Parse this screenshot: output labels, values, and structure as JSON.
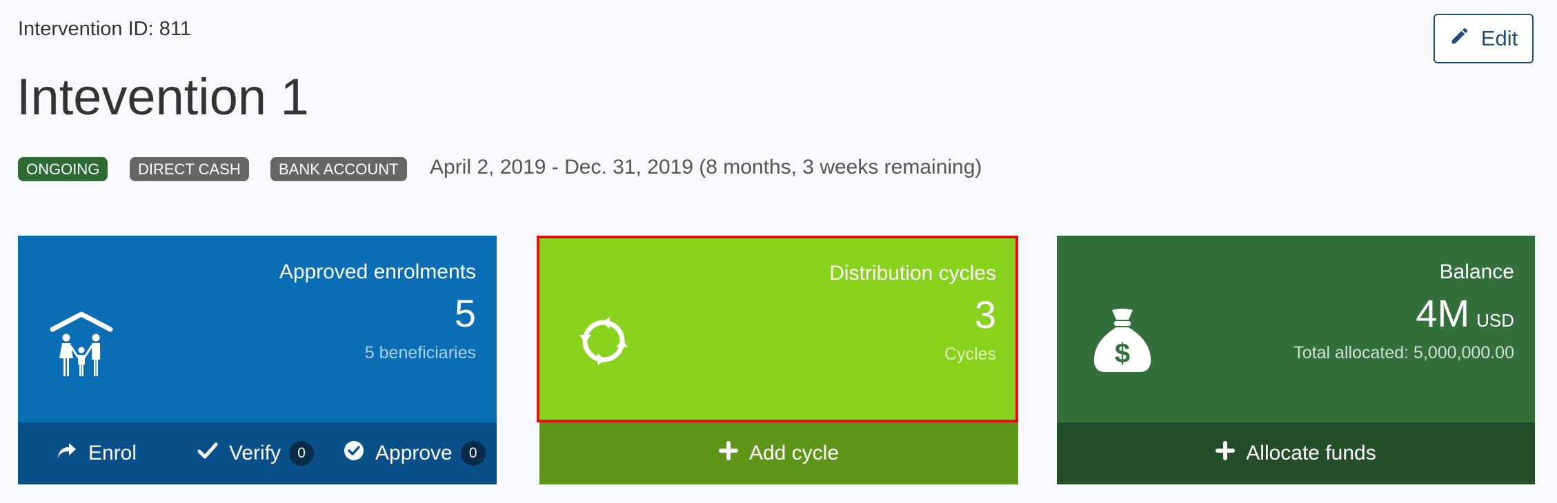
{
  "header": {
    "intervention_id": "Intervention ID: 811",
    "title": "Intevention 1",
    "edit_label": "Edit",
    "badges": {
      "status": "ONGOING",
      "type": "DIRECT CASH",
      "method": "BANK ACCOUNT"
    },
    "date_range": "April 2, 2019 - Dec. 31, 2019 (8 months, 3 weeks remaining)"
  },
  "cards": {
    "enrolments": {
      "title": "Approved enrolments",
      "value": "5",
      "subtitle": "5 beneficiaries",
      "icon": "family-shelter-icon",
      "color": "#0b6db4",
      "actions": {
        "enrol": "Enrol",
        "verify": "Verify",
        "verify_count": "0",
        "approve": "Approve",
        "approve_count": "0"
      }
    },
    "cycles": {
      "title": "Distribution cycles",
      "value": "3",
      "subtitle": "Cycles",
      "icon": "refresh-cycle-icon",
      "color": "#88d11d",
      "highlight_color": "#e01010",
      "action": "Add cycle"
    },
    "balance": {
      "title": "Balance",
      "value": "4M",
      "unit": "USD",
      "subtitle": "Total allocated: 5,000,000.00",
      "icon": "money-bag-icon",
      "color": "#326f3a",
      "action": "Allocate funds"
    }
  }
}
